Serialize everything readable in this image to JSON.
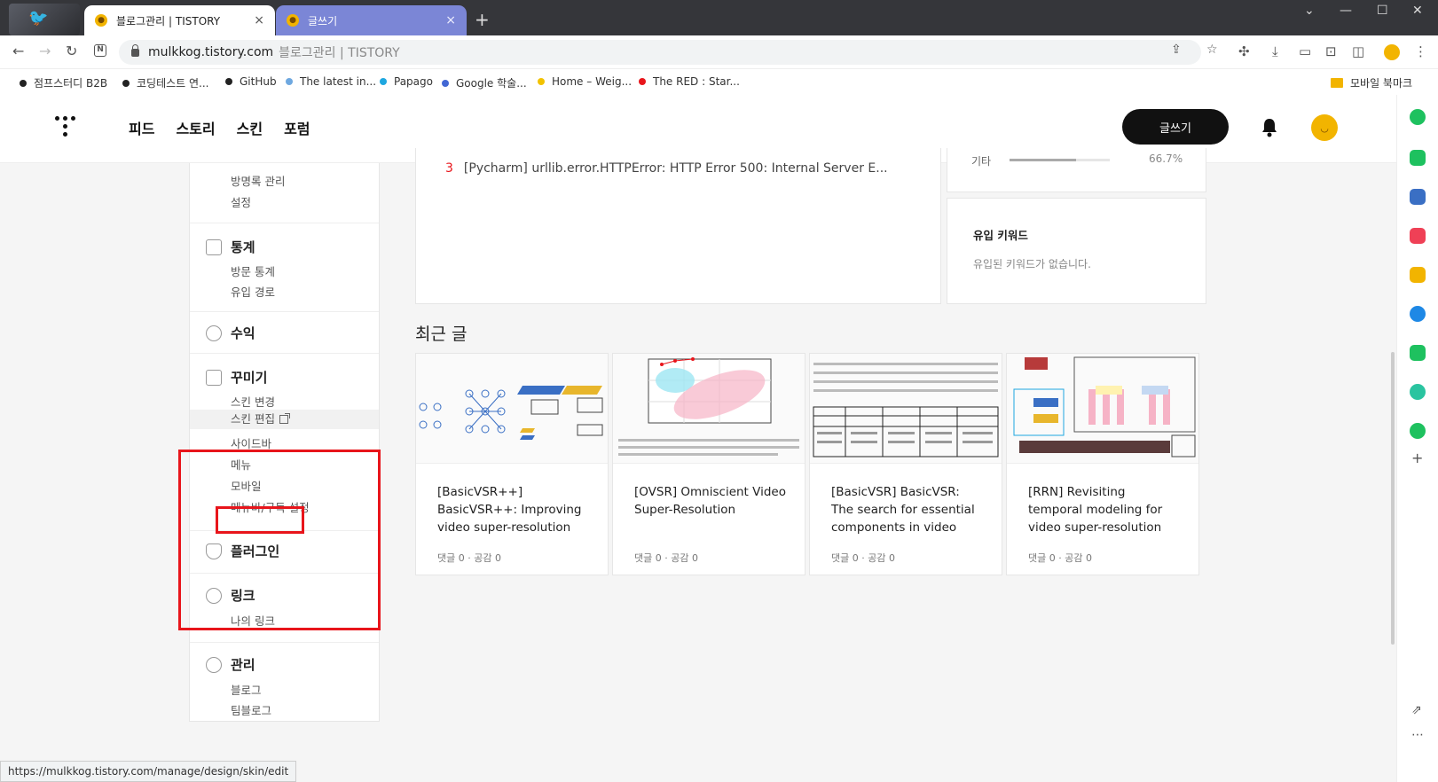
{
  "browser": {
    "tabs": [
      {
        "title": "블로그관리 | TISTORY",
        "active": true
      },
      {
        "title": "글쓰기",
        "active": false
      }
    ],
    "new_tab": "+",
    "address": {
      "host": "mulkkog.tistory.com",
      "title": "블로그관리 | TISTORY"
    },
    "bookmarks": [
      {
        "label": "점프스터디 B2B",
        "color": "#222222"
      },
      {
        "label": "코딩테스트 연...",
        "color": "#222222"
      },
      {
        "label": "GitHub",
        "color": "#222222"
      },
      {
        "label": "The latest in...",
        "color": "#6ea8e0"
      },
      {
        "label": "Papago",
        "color": "#1ea7e0"
      },
      {
        "label": "Google 학술...",
        "color": "#4267d4"
      },
      {
        "label": "Home – Weig...",
        "color": "#f2c200"
      },
      {
        "label": "The RED : Star...",
        "color": "#e8151b"
      }
    ],
    "bookmark_folder": "모바일 북마크",
    "status_url": "https://mulkkog.tistory.com/manage/design/skin/edit"
  },
  "gnb": {
    "menu": [
      "피드",
      "스토리",
      "스킨",
      "포럼"
    ],
    "write_button": "글쓰기"
  },
  "sidebar": {
    "partial": {
      "items": [
        "방명록 관리",
        "설정"
      ]
    },
    "stats": {
      "title": "통계",
      "items": [
        "방문 통계",
        "유입 경로"
      ]
    },
    "revenue": {
      "title": "수익"
    },
    "decorate": {
      "title": "꾸미기",
      "items": [
        "스킨 변경",
        "스킨 편집",
        "사이드바",
        "메뉴",
        "모바일",
        "메뉴바/구독 설정"
      ]
    },
    "plugin": {
      "title": "플러그인"
    },
    "link": {
      "title": "링크",
      "items": [
        "나의 링크"
      ]
    },
    "manage": {
      "title": "관리",
      "items": [
        "블로그",
        "팀블로그"
      ]
    }
  },
  "popular": {
    "rank": "3",
    "title": "[Pycharm] urllib.error.HTTPError: HTTP Error 500: Internal Server E..."
  },
  "inflow_stats": {
    "label": "기타",
    "percent": "66.7%",
    "fraction": 0.667
  },
  "keywords": {
    "title": "유입 키워드",
    "empty": "유입된 키워드가 없습니다."
  },
  "recent": {
    "title": "최근 글",
    "cards": [
      {
        "title": "[BasicVSR++] BasicVSR++: Improving video super-resolution with enhanced …",
        "meta": "댓글 0 · 공감 0"
      },
      {
        "title": "[OVSR] Omniscient Video Super-Resolution",
        "meta": "댓글 0 · 공감 0"
      },
      {
        "title": "[BasicVSR] BasicVSR: The search for essential components in video super-r…",
        "meta": "댓글 0 · 공감 0"
      },
      {
        "title": "[RRN] Revisiting temporal modeling for video super-resolution",
        "meta": "댓글 0 · 공감 0"
      }
    ]
  },
  "colors": {
    "accent": "#e8151b",
    "dark": "#111111",
    "tab_inactive": "#7b86d6"
  }
}
